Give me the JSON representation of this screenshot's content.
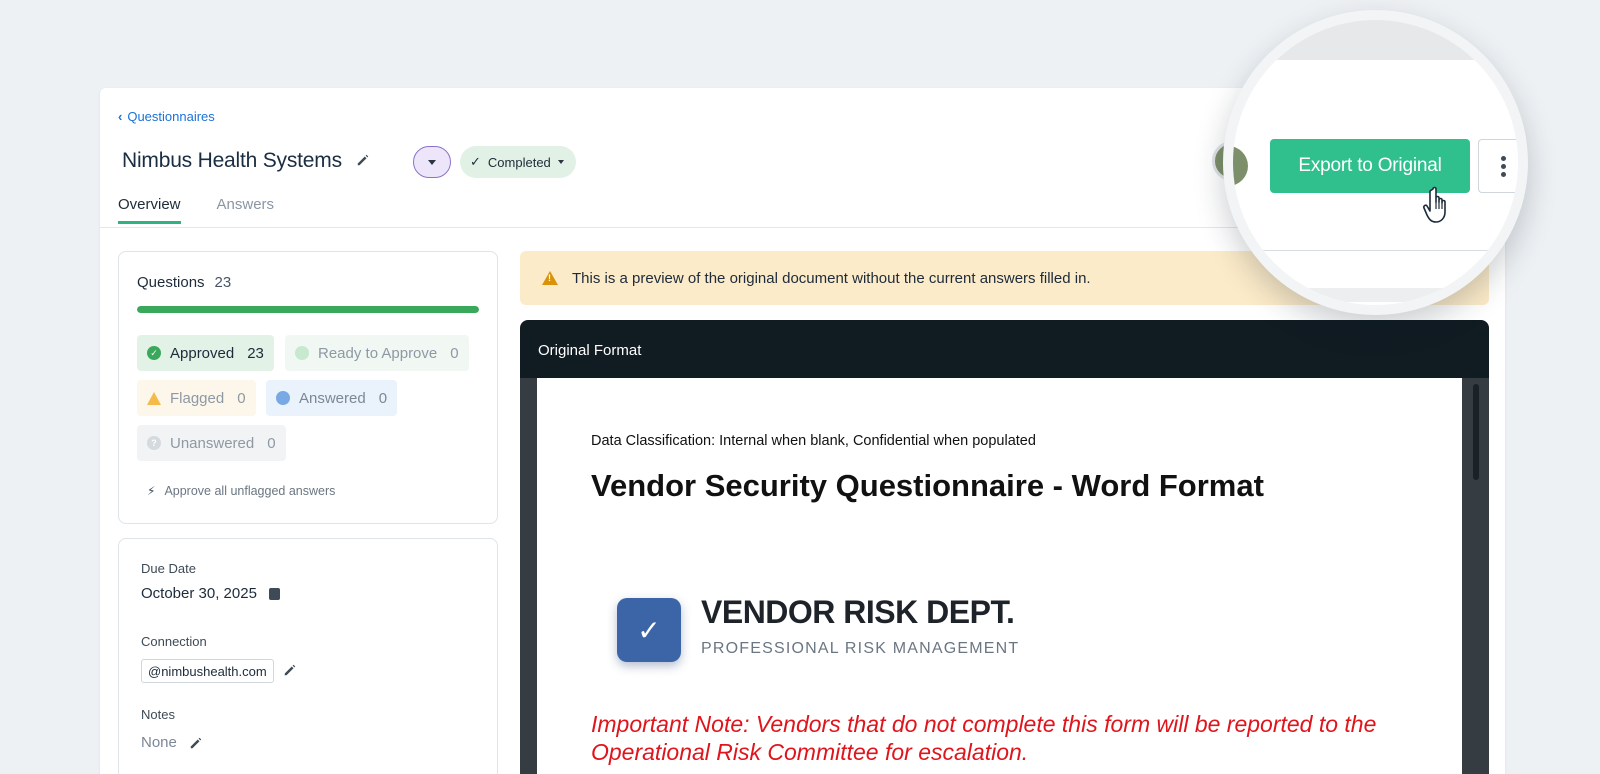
{
  "breadcrumb": {
    "back_label": "Questionnaires"
  },
  "header": {
    "title": "Nimbus Health Systems",
    "status_label": "Completed"
  },
  "tabs": [
    {
      "label": "Overview",
      "active": true
    },
    {
      "label": "Answers",
      "active": false
    }
  ],
  "actions": {
    "export_label": "Export to Original"
  },
  "questions": {
    "label": "Questions",
    "total": "23",
    "progress_fraction": 1.0,
    "approved": {
      "label": "Approved",
      "count": "23"
    },
    "ready": {
      "label": "Ready to Approve",
      "count": "0"
    },
    "flagged": {
      "label": "Flagged",
      "count": "0"
    },
    "answered": {
      "label": "Answered",
      "count": "0"
    },
    "unanswered": {
      "label": "Unanswered",
      "count": "0"
    },
    "approve_all_label": "Approve all unflagged answers"
  },
  "details": {
    "due_date_label": "Due Date",
    "due_date_value": "October 30, 2025",
    "connection_label": "Connection",
    "connection_value": "@nimbushealth.com",
    "notes_label": "Notes",
    "notes_value": "None"
  },
  "banner": {
    "text": "This is a preview of the original document without the current answers filled in."
  },
  "viewer": {
    "title": "Original Format",
    "classification": "Data Classification: Internal when blank, Confidential when populated",
    "doc_title": "Vendor Security Questionnaire - Word Format",
    "logo_name": "VENDOR RISK DEPT.",
    "logo_sub": "PROFESSIONAL RISK MANAGEMENT",
    "note": "Important Note: Vendors that do not complete this form will be reported to the Operational Risk Committee for escalation."
  },
  "colors": {
    "accent_green": "#2fc08d",
    "approved_green": "#3aa85b",
    "link_blue": "#1a73d9",
    "banner_bg": "#fcebc9",
    "note_red": "#e0141b"
  }
}
